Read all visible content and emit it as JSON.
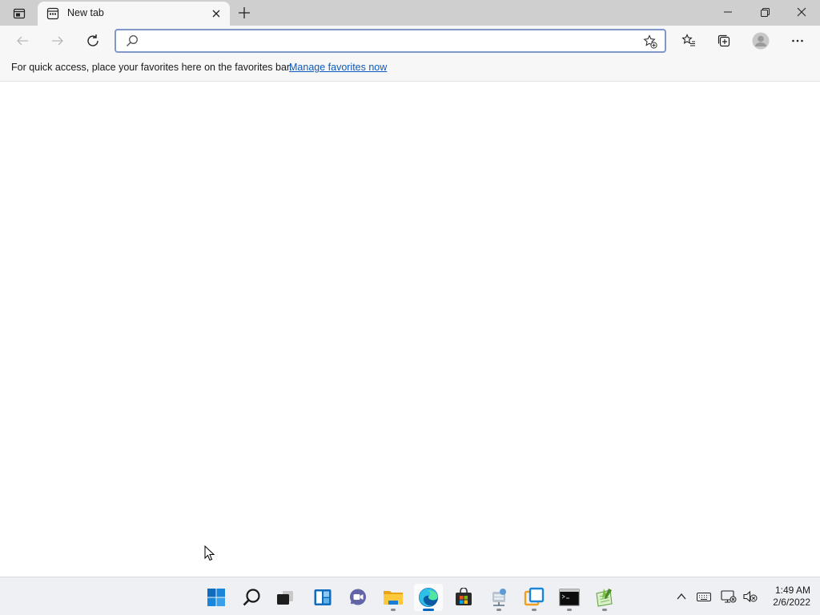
{
  "browser": {
    "tab": {
      "title": "New tab"
    },
    "address_bar": {
      "value": "",
      "placeholder": ""
    },
    "favorites_bar": {
      "message": "For quick access, place your favorites here on the favorites bar.",
      "link_label": "Manage favorites now"
    }
  },
  "taskbar": {
    "apps": [
      {
        "name": "Start",
        "icon": "windows-start-icon",
        "running": false
      },
      {
        "name": "Search",
        "icon": "search-icon",
        "running": false
      },
      {
        "name": "Task View",
        "icon": "task-view-icon",
        "running": false
      },
      {
        "name": "Widgets",
        "icon": "widgets-icon",
        "running": false
      },
      {
        "name": "Chat",
        "icon": "teams-chat-icon",
        "running": false
      },
      {
        "name": "File Explorer",
        "icon": "folder-icon",
        "running": true
      },
      {
        "name": "Microsoft Edge",
        "icon": "edge-icon",
        "running": true,
        "active": true
      },
      {
        "name": "Microsoft Store",
        "icon": "store-icon",
        "running": false
      },
      {
        "name": "Network drive",
        "icon": "network-drive-icon",
        "running": true
      },
      {
        "name": "Virtual machine",
        "icon": "vm-window-icon",
        "running": true
      },
      {
        "name": "Command Prompt",
        "icon": "terminal-icon",
        "running": true
      },
      {
        "name": "Notepad++",
        "icon": "notepad-plus-icon",
        "running": true
      }
    ],
    "clock": {
      "time": "1:49 AM",
      "date": "2/6/2022"
    }
  },
  "colors": {
    "accent": "#0067c0",
    "link": "#0f5ab8",
    "tab_strip": "#cfcfcf",
    "toolbar": "#f7f7f7"
  }
}
